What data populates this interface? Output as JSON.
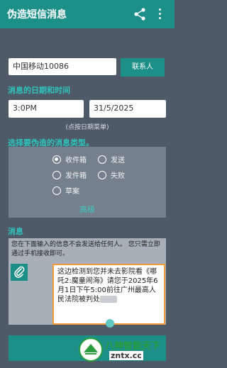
{
  "app_bar": {
    "title": "伪造短信消息"
  },
  "sender": {
    "value": "中国移动10086",
    "contact_button": "联系人"
  },
  "datetime": {
    "section_label": "消息的日期和时间",
    "time": "3:0PM",
    "date": "31/5/2025",
    "hint": "(点按日期菜单)"
  },
  "message_type": {
    "section_label": "选择要伪造的消息类型。",
    "options": [
      "收件箱",
      "发送",
      "发件箱",
      "失败",
      "草案"
    ],
    "selected": "收件箱",
    "advanced_label": "高级"
  },
  "message": {
    "section_label": "消息",
    "warning": "您在下面输入的信息不会发送给任何人。 您只需立即通过手机接收即可。",
    "body": "这边检测到您并未去影院看《哪吒2:魔童闹海》请您于2025年6月1日下午5:00前往广州最高人民法院被判处"
  },
  "watermark": {
    "line1": "八神智能天下",
    "line2": "zntx.cc"
  },
  "colors": {
    "accent": "#1b8f88",
    "label": "#2ec4bf",
    "background": "#4e5a67",
    "highlight_border": "#f19a3a"
  },
  "icons": {
    "share": "share-icon",
    "more": "more-vert-icon",
    "attach": "paperclip-icon"
  }
}
